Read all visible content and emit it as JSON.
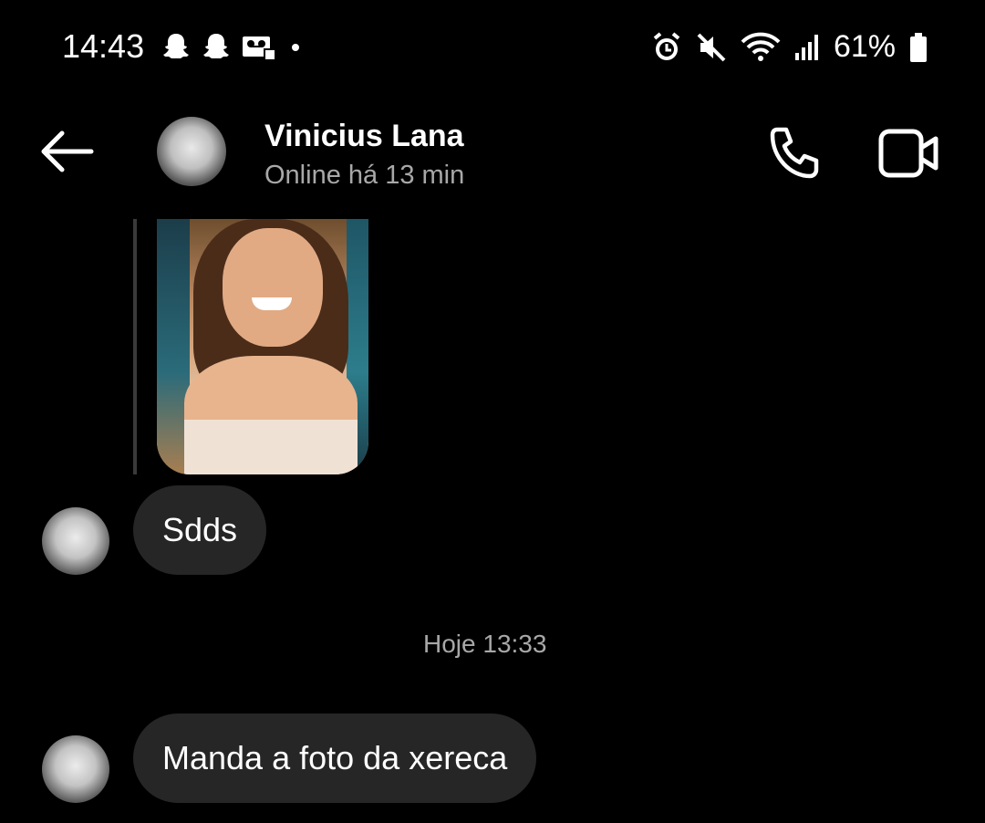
{
  "status_bar": {
    "time": "14:43",
    "battery": "61%",
    "left_icons": [
      "snapchat-icon",
      "snapchat-icon",
      "voicemail-icon",
      "dot-icon"
    ],
    "right_icons": [
      "alarm-icon",
      "mute-icon",
      "wifi-icon",
      "signal-icon",
      "battery-icon"
    ]
  },
  "header": {
    "contact_name": "Vinicius Lana",
    "contact_status": "Online há 13 min",
    "icons": [
      "back-arrow-icon",
      "phone-icon",
      "video-camera-icon"
    ]
  },
  "messages": [
    {
      "type": "photo",
      "sender": "them"
    },
    {
      "type": "text",
      "sender": "them",
      "text": "Sdds"
    },
    {
      "type": "timestamp",
      "text": "Hoje 13:33"
    },
    {
      "type": "text",
      "sender": "them",
      "text": "Manda a foto da xereca"
    }
  ],
  "colors": {
    "background": "#000000",
    "bubble": "#262626",
    "secondary_text": "#a8a8a8"
  }
}
